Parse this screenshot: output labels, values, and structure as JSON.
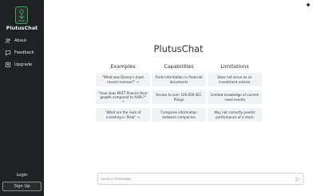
{
  "sidebar": {
    "brand": "PlutusChat",
    "items": [
      {
        "label": "About",
        "icon": "users-icon"
      },
      {
        "label": "Feedback",
        "icon": "chat-bubble-icon"
      },
      {
        "label": "Upgrade",
        "icon": "upgrade-icon"
      }
    ],
    "login_label": "Login",
    "signup_label": "Sign Up"
  },
  "main": {
    "title": "PlutusChat",
    "columns": [
      {
        "heading": "Examples",
        "cards": [
          "\"What was Disney's most recent revenue?\" →",
          "\"How does MSFT finance their growth compared to AAPL?\" →",
          "\"What are the risks of investing in Tesla\" →"
        ]
      },
      {
        "heading": "Capabilities",
        "cards": [
          "Finds information in financial documents",
          "Access to over 100,000 SEC filings",
          "Compares information between companies"
        ]
      },
      {
        "heading": "Limitations",
        "cards": [
          "Does not serve as an investment advisor",
          "Limited knowledge of current news events",
          "May not correctly predict performance of a stock"
        ]
      }
    ]
  },
  "composer": {
    "placeholder": "Send a message.",
    "value": ""
  },
  "colors": {
    "sidebar_bg": "#202123",
    "card_bg": "#f1f3f5",
    "accent": "#3ba55c"
  }
}
